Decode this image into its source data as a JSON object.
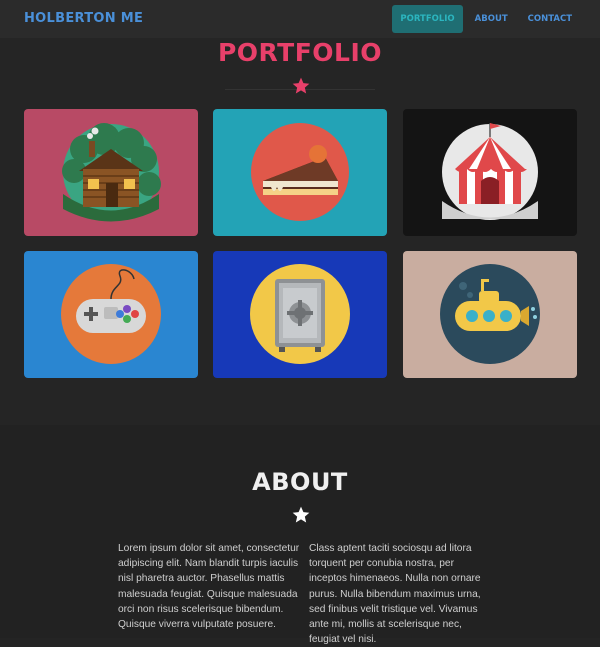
{
  "nav": {
    "brand": "HOLBERTON ME",
    "links": [
      {
        "label": "PORTFOLIO",
        "active": true
      },
      {
        "label": "ABOUT",
        "active": false
      },
      {
        "label": "CONTACT",
        "active": false
      }
    ]
  },
  "portfolio": {
    "title": "PORTFOLIO",
    "items": [
      {
        "icon": "cabin-icon",
        "background": "#b84a65"
      },
      {
        "icon": "cake-icon",
        "background": "#23a3b6"
      },
      {
        "icon": "circus-tent-icon",
        "background": "#141414"
      },
      {
        "icon": "game-controller-icon",
        "background": "#2a86d1"
      },
      {
        "icon": "safe-icon",
        "background": "#1739b8"
      },
      {
        "icon": "submarine-icon",
        "background": "#c9ada0"
      }
    ]
  },
  "about": {
    "title": "ABOUT",
    "col1": "Lorem ipsum dolor sit amet, consectetur adipiscing elit. Nam blandit turpis iaculis nisl pharetra auctor. Phasellus mattis malesuada feugiat. Quisque malesuada orci non risus scelerisque bibendum. Quisque viverra vulputate posuere.",
    "col2": "Class aptent taciti sociosqu ad litora torquent per conubia nostra, per inceptos himenaeos. Nulla non ornare purus. Nulla bibendum maximus urna, sed finibus velit tristique vel. Vivamus ante mi, mollis at scelerisque nec, feugiat vel nisi."
  },
  "colors": {
    "accent_pink": "#e8406a",
    "nav_blue": "#4a90d9",
    "nav_active_bg": "#1f6e73"
  }
}
